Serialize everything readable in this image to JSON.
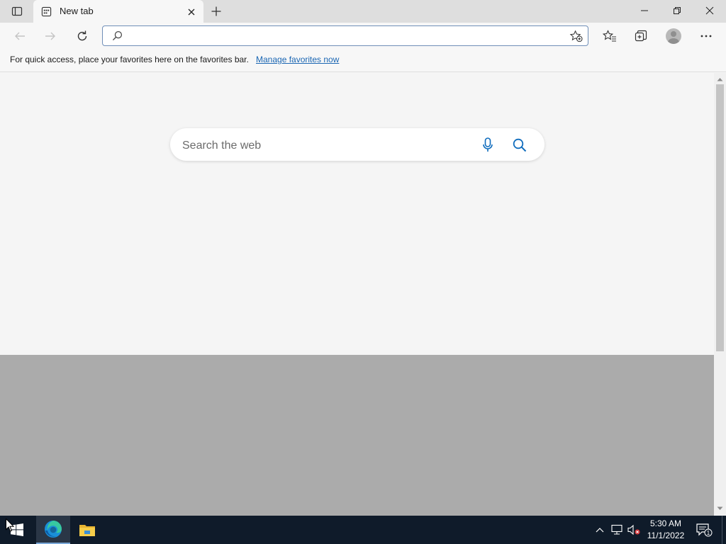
{
  "browser": {
    "tab": {
      "title": "New tab"
    },
    "address_bar": {
      "value": "",
      "placeholder": ""
    }
  },
  "favorites_bar": {
    "message": "For quick access, place your favorites here on the favorites bar.",
    "link": "Manage favorites now"
  },
  "new_tab_page": {
    "search": {
      "placeholder": "Search the web",
      "value": ""
    }
  },
  "taskbar": {
    "apps": [
      "microsoft-edge",
      "file-explorer"
    ],
    "clock": {
      "time": "5:30 AM",
      "date": "11/1/2022"
    },
    "notifications": {
      "count": "1"
    }
  },
  "colors": {
    "accent": "#0f6cbd",
    "link": "#1a66b3",
    "taskbar": "#0f1b2a",
    "tab_strip": "#dedede"
  }
}
